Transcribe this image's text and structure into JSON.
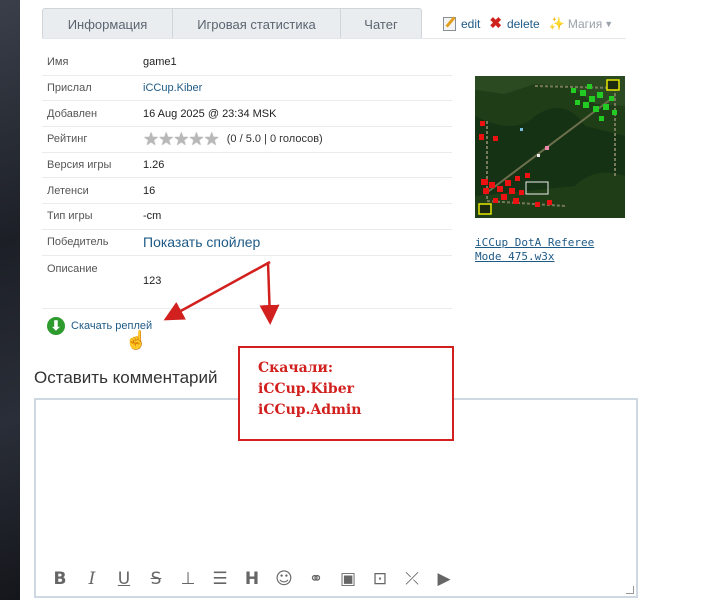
{
  "tabs": [
    {
      "label": "Информация"
    },
    {
      "label": "Игровая статистика"
    },
    {
      "label": "Чатег"
    }
  ],
  "actions": {
    "edit_label": "edit",
    "delete_label": "delete",
    "magic_label": "Магия"
  },
  "info": {
    "name_label": "Имя",
    "name_value": "game1",
    "sender_label": "Прислал",
    "sender_value": "iCCup.Kiber",
    "added_label": "Добавлен",
    "added_value": "16 Aug 2025 @ 23:34 MSK",
    "rating_label": "Рейтинг",
    "rating_text": "(0 / 5.0 | 0 голосов)",
    "rating_stars": 0,
    "rating_max": 5,
    "version_label": "Версия игры",
    "version_value": "1.26",
    "duration_label": "Летенси",
    "duration_value": "16",
    "type_label": "Тип игры",
    "type_value": "-cm",
    "winner_label": "Победитель",
    "winner_value": "Показать спойлер",
    "desc_label": "Описание",
    "desc_value": "123"
  },
  "download": {
    "label": "Скачать реплей"
  },
  "map": {
    "name": "iCCup DotA Referee Mode 475.w3x"
  },
  "comment": {
    "heading": "Оставить комментарий"
  },
  "annotation": {
    "title": "Скачали:",
    "users": [
      "iCCup.Kiber",
      "iCCup.Admin"
    ],
    "color": "#d1201e"
  },
  "colors": {
    "link": "#1e5a86",
    "tab_bg": "#eaedf0",
    "annotation_red": "#d1201e"
  },
  "toolbar_icons": [
    "bold-icon",
    "italic-icon",
    "underline-icon",
    "strikethrough-icon",
    "text-height-icon",
    "list-icon",
    "heading-icon",
    "smile-icon",
    "link-icon",
    "image-icon",
    "image-resize-icon",
    "compress-icon",
    "youtube-icon"
  ]
}
